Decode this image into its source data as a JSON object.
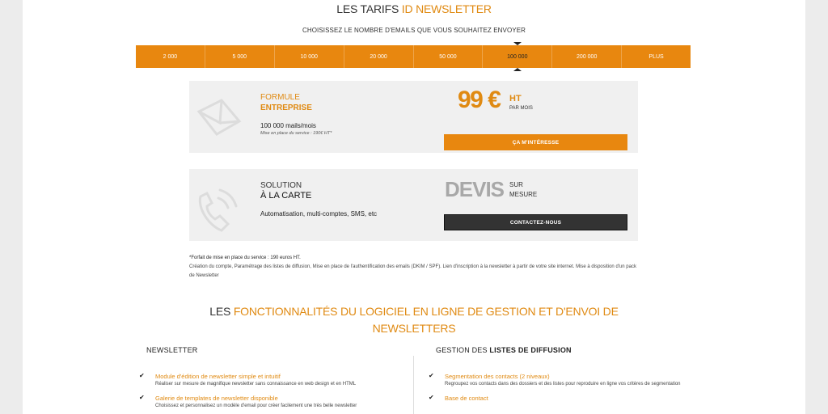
{
  "header": {
    "title_plain": "LES TARIFS ",
    "title_accent": "ID NEWSLETTER",
    "subtitle": "CHOISISSEZ LE NOMBRE D'EMAILS QUE VOUS SOUHAITEZ ENVOYER"
  },
  "volumes": [
    {
      "label": "2 000",
      "active": false
    },
    {
      "label": "5 000",
      "active": false
    },
    {
      "label": "10 000",
      "active": false
    },
    {
      "label": "20 000",
      "active": false
    },
    {
      "label": "50 000",
      "active": false
    },
    {
      "label": "100 000",
      "active": true
    },
    {
      "label": "200 000",
      "active": false
    },
    {
      "label": "PLUS",
      "active": false
    }
  ],
  "plan_offer": {
    "kicker": "FORMULE",
    "name": "ENTREPRISE",
    "mails": "100 000 mails/mois",
    "setup_note": "Mise en place du service : 190€ HT*",
    "price": "99 €",
    "price_ht": "HT",
    "price_period": "PAR MOIS",
    "button": "ÇA M'INTÉRESSE",
    "icon": "envelope-icon"
  },
  "custom_offer": {
    "kicker": "SOLUTION",
    "name": "À LA CARTE",
    "features": "Automatisation, multi-comptes, SMS, etc",
    "devis": "DEVIS",
    "devis_sub1": "SUR",
    "devis_sub2": "MESURE",
    "button": "CONTACTEZ-NOUS",
    "icon": "phone-icon"
  },
  "footnote": {
    "line1": "*Forfait de mise en place du service : 190 euros HT.",
    "line2": "Création du compte, Paramétrage des listes de diffusion, Mise en place de l'authentification des emails (DKIM / SPF). Lien d'inscription à la newsletter à partir de votre site internet. Mise à disposition d'un pack de Newsletter"
  },
  "features_title": {
    "prefix": "LES ",
    "accent": "FONCTIONNALITÉS DU LOGICIEL EN LIGNE DE GESTION ET D'ENVOI DE NEWSLETTERS"
  },
  "newsletter_col": {
    "heading": "NEWSLETTER",
    "items": [
      {
        "title": "Module d'édition de newsletter simple et intuitif",
        "desc": "Réaliser sur mesure de magnifique newsletter sans connaissance en web design et en HTML"
      },
      {
        "title": "Galerie de templates de newsletter disponible",
        "desc": "Choisissez et personnalisez un modèle d'email pour créer facilement une très belle newsletter"
      }
    ]
  },
  "lists_col": {
    "heading_prefix": "GESTION DES ",
    "heading_bold": "LISTES DE DIFFUSION",
    "items": [
      {
        "title": "Segmentation des contacts (2 niveaux)",
        "desc": "Regroupez vos contacts dans des dossiers et des listes pour reproduire en ligne vos critères de segmentation"
      },
      {
        "title": "Base de contact",
        "desc": ""
      }
    ]
  },
  "colors": {
    "accent": "#e8870f",
    "dark_button": "#333333",
    "card_bg": "#f0f0f0"
  }
}
